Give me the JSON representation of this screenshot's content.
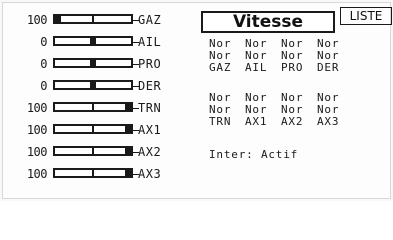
{
  "channels": [
    {
      "value": "100",
      "label": "GAZ",
      "marker_pct": 0
    },
    {
      "value": "0",
      "label": "AIL",
      "marker_pct": 50
    },
    {
      "value": "0",
      "label": "PRO",
      "marker_pct": 50
    },
    {
      "value": "0",
      "label": "DER",
      "marker_pct": 50
    },
    {
      "value": "100",
      "label": "TRN",
      "marker_pct": 100
    },
    {
      "value": "100",
      "label": "AX1",
      "marker_pct": 100
    },
    {
      "value": "100",
      "label": "AX2",
      "marker_pct": 100
    },
    {
      "value": "100",
      "label": "AX3",
      "marker_pct": 100
    }
  ],
  "header": {
    "title": "Vitesse",
    "liste": "LISTE"
  },
  "group1": {
    "rows": [
      [
        "Nor",
        "Nor",
        "Nor",
        "Nor"
      ],
      [
        "Nor",
        "Nor",
        "Nor",
        "Nor"
      ]
    ],
    "labels": [
      "GAZ",
      "AIL",
      "PRO",
      "DER"
    ]
  },
  "group2": {
    "rows": [
      [
        "Nor",
        "Nor",
        "Nor",
        "Nor"
      ],
      [
        "Nor",
        "Nor",
        "Nor",
        "Nor"
      ]
    ],
    "labels": [
      "TRN",
      "AX1",
      "AX2",
      "AX3"
    ]
  },
  "inter": "Inter: Actif"
}
